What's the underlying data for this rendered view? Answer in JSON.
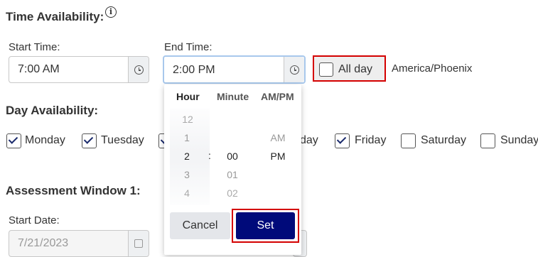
{
  "time_section": {
    "title": "Time Availability:",
    "info_symbol": "i",
    "start_label": "Start Time:",
    "start_value": "7:00 AM",
    "end_label": "End Time:",
    "end_value": "2:00 PM",
    "allday_label": "All day",
    "allday_checked": false,
    "timezone": "America/Phoenix"
  },
  "day_section": {
    "title": "Day Availability:",
    "days": [
      {
        "label": "Monday",
        "checked": true
      },
      {
        "label": "Tuesday",
        "checked": true
      },
      {
        "label": "day",
        "checked": true
      },
      {
        "label": "Friday",
        "checked": true
      },
      {
        "label": "Saturday",
        "checked": false
      },
      {
        "label": "Sunday",
        "checked": false
      }
    ]
  },
  "assessment": {
    "title": "Assessment Window 1:",
    "start_date_label": "Start Date:",
    "start_date_value": "7/21/2023"
  },
  "time_picker": {
    "columns": [
      "Hour",
      "Minute",
      "AM/PM"
    ],
    "hours": [
      "12",
      "1",
      "2",
      "3",
      "4"
    ],
    "separator": ":",
    "minutes": [
      "00",
      "01",
      "02"
    ],
    "ampm": [
      "AM",
      "PM"
    ],
    "cancel_label": "Cancel",
    "set_label": "Set"
  },
  "colors": {
    "highlight_red": "#d40000",
    "primary_navy": "#000a7a",
    "focus_blue": "#a8c8ec"
  }
}
